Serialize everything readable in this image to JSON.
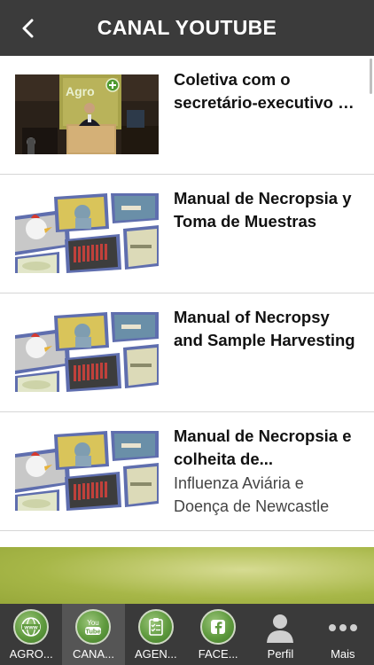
{
  "header": {
    "title": "CANAL YOUTUBE"
  },
  "videos": [
    {
      "title": "Coletiva com o secretário-executivo do MAPA",
      "subtitle": ""
    },
    {
      "title": "Manual de Necropsia y Toma de Muestras",
      "subtitle": ""
    },
    {
      "title": "Manual of Necropsy and Sample Harvesting",
      "subtitle": ""
    },
    {
      "title": "Manual de Necropsia e colheita de...",
      "subtitle": "Influenza Aviária e Doença de Newcastle"
    }
  ],
  "thumbnails": {
    "logo_text": "Agro"
  },
  "tabs": [
    {
      "label": "AGRO...",
      "icon": "globe-www-icon"
    },
    {
      "label": "CANA...",
      "icon": "youtube-icon",
      "icon_text": "You Tube"
    },
    {
      "label": "AGEN...",
      "icon": "calendar-checklist-icon"
    },
    {
      "label": "FACE...",
      "icon": "facebook-icon"
    },
    {
      "label": "Perfil",
      "icon": "user-profile-icon"
    },
    {
      "label": "Mais",
      "icon": "more-dots-icon"
    }
  ],
  "colors": {
    "header_bg": "#3b3b3b",
    "tabbar_bg": "#3a3a3a",
    "tab_active_bg": "#555555",
    "icon_green": "#5f9a3e",
    "banner_green": "#a7b748"
  }
}
